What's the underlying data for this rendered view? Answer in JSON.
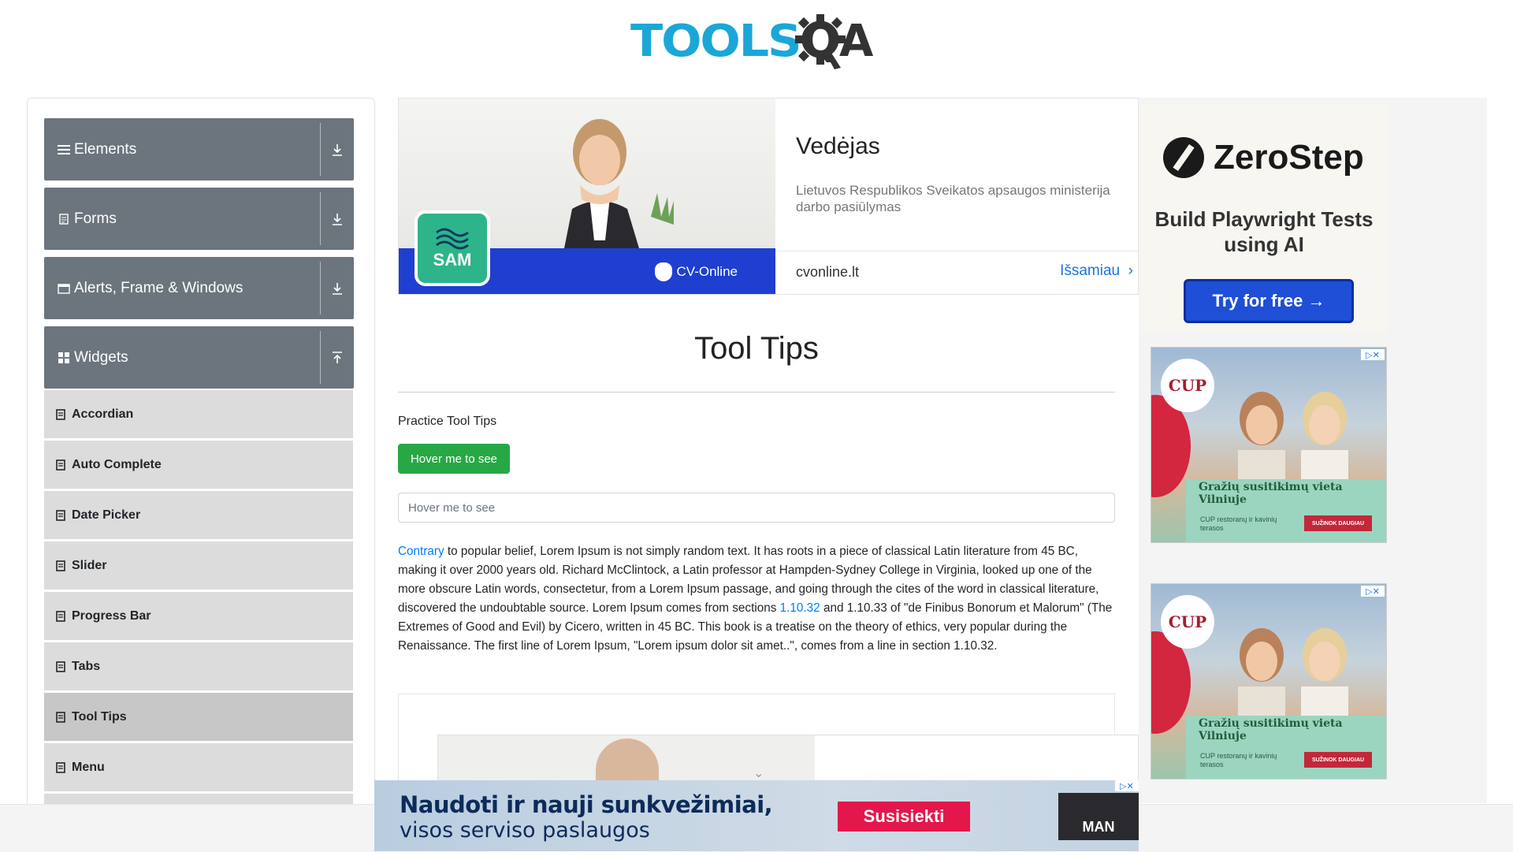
{
  "header": {
    "logo_tools": "TOOLS",
    "logo_qa": "QA"
  },
  "sidebar": {
    "groups": [
      {
        "label": "Elements",
        "icon": "hamburger-icon",
        "arrow": "download-icon"
      },
      {
        "label": "Forms",
        "icon": "form-icon",
        "arrow": "download-icon"
      },
      {
        "label": "Alerts, Frame & Windows",
        "icon": "window-icon",
        "arrow": "download-icon"
      },
      {
        "label": "Widgets",
        "icon": "grid-icon",
        "arrow": "upload-icon"
      }
    ],
    "items": [
      {
        "label": "Accordian"
      },
      {
        "label": "Auto Complete"
      },
      {
        "label": "Date Picker"
      },
      {
        "label": "Slider"
      },
      {
        "label": "Progress Bar"
      },
      {
        "label": "Tabs"
      },
      {
        "label": "Tool Tips"
      },
      {
        "label": "Menu"
      }
    ],
    "active_item": "Tool Tips"
  },
  "top_ad": {
    "badge": "SAM",
    "brand": "CV-Online",
    "title": "Vedėjas",
    "subtitle": "Lietuvos Respublikos Sveikatos apsaugos ministerija darbo pasiūlymas",
    "domain": "cvonline.lt",
    "more": "Išsamiau"
  },
  "main": {
    "title": "Tool Tips",
    "practice_label": "Practice Tool Tips",
    "button_label": "Hover me to see",
    "input_placeholder": "Hover me to see",
    "paragraph": {
      "link1": "Contrary",
      "text1": " to popular belief, Lorem Ipsum is not simply random text. It has roots in a piece of classical Latin literature from 45 BC, making it over 2000 years old. Richard McClintock, a Latin professor at Hampden-Sydney College in Virginia, looked up one of the more obscure Latin words, consectetur, from a Lorem Ipsum passage, and going through the cites of the word in classical literature, discovered the undoubtable source. Lorem Ipsum comes from sections ",
      "link2": "1.10.32",
      "text2": " and 1.10.33 of \"de Finibus Bonorum et Malorum\" (The Extremes of Good and Evil) by Cicero, written in 45 BC. This book is a treatise on the theory of ethics, very popular during the Renaissance. The first line of Lorem Ipsum, \"Lorem ipsum dolor sit amet..\", comes from a line in section 1.10.32."
    }
  },
  "right_ads": {
    "zerostep": {
      "brand": "ZeroStep",
      "headline": "Build Playwright Tests using AI",
      "cta": "Try for free →"
    },
    "cup": {
      "logo": "CUP",
      "slogan": "Gražių susitikimų vieta Vilniuje",
      "small": "CUP restoranų ir kavinių terasos",
      "cta": "SUŽINOK DAUGIAU"
    }
  },
  "bottom_banner": {
    "line1": "Naudoti ir nauji sunkvežimiai,",
    "line2": "visos serviso paslaugos",
    "cta": "Susisiekti",
    "brand": "MAN"
  },
  "colors": {
    "sidebar_group": "#6c757d",
    "sidebar_item": "#dcdcdc",
    "button_green": "#28a745",
    "link_blue": "#007bff",
    "logo_blue": "#1aa7d8"
  }
}
